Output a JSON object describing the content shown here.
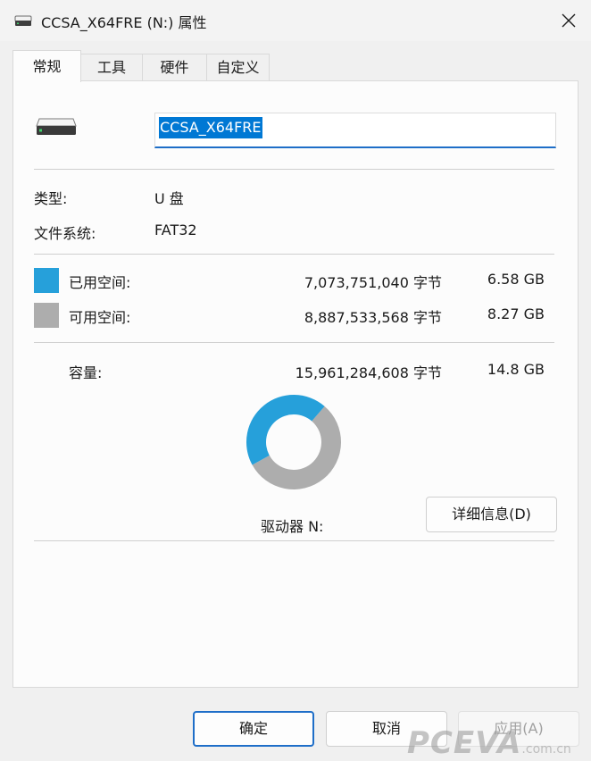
{
  "window": {
    "title": "CCSA_X64FRE (N:) 属性"
  },
  "tabs": [
    {
      "label": "常规"
    },
    {
      "label": "工具"
    },
    {
      "label": "硬件"
    },
    {
      "label": "自定义"
    }
  ],
  "general": {
    "name_value": "CCSA_X64FRE",
    "type_label": "类型:",
    "type_value": "U 盘",
    "fs_label": "文件系统:",
    "fs_value": "FAT32",
    "used_label": "已用空间:",
    "used_bytes": "7,073,751,040 字节",
    "used_size": "6.58 GB",
    "free_label": "可用空间:",
    "free_bytes": "8,887,533,568 字节",
    "free_size": "8.27 GB",
    "capacity_label": "容量:",
    "capacity_bytes": "15,961,284,608 字节",
    "capacity_size": "14.8 GB",
    "drive_label": "驱动器 N:",
    "details_button": "详细信息(D)",
    "used_fraction": 0.4432
  },
  "colors": {
    "used": "#26a0da",
    "free": "#adadad",
    "accent": "#1e6ec8"
  },
  "footer": {
    "ok": "确定",
    "cancel": "取消",
    "apply": "应用(A)"
  },
  "watermark": {
    "brand": "PCEVA",
    "domain": ".com.cn"
  }
}
